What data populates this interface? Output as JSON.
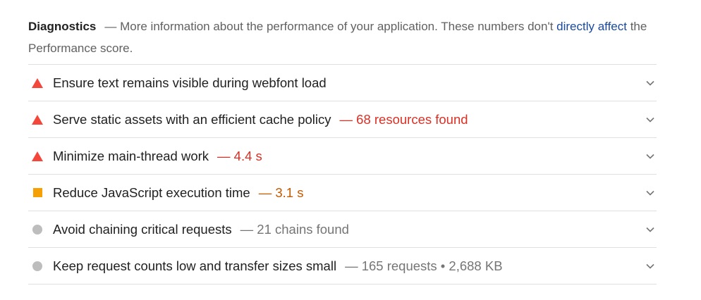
{
  "diagnostics": {
    "title": "Diagnostics",
    "description_prefix": "— More information about the performance of your application. These numbers don't ",
    "description_link": "directly affect",
    "description_suffix": " the Performance score."
  },
  "audits": [
    {
      "label": "Ensure text remains visible during webfont load",
      "metric": "",
      "status": "fail",
      "icon": "warning-triangle-icon"
    },
    {
      "label": "Serve static assets with an efficient cache policy",
      "metric": "— 68 resources found",
      "status": "fail",
      "icon": "warning-triangle-icon"
    },
    {
      "label": "Minimize main-thread work",
      "metric": "— 4.4 s",
      "status": "fail",
      "icon": "warning-triangle-icon"
    },
    {
      "label": "Reduce JavaScript execution time",
      "metric": "— 3.1 s",
      "status": "average",
      "icon": "orange-square-icon"
    },
    {
      "label": "Avoid chaining critical requests",
      "metric": "— 21 chains found",
      "status": "info",
      "icon": "gray-circle-icon"
    },
    {
      "label": "Keep request counts low and transfer sizes small",
      "metric": "— 165 requests • 2,688 KB",
      "status": "info",
      "icon": "gray-circle-icon"
    }
  ],
  "colors": {
    "fail": "#f4473b",
    "average": "#f5a105",
    "info": "#bdbdbd",
    "link": "#1a4aa0"
  }
}
